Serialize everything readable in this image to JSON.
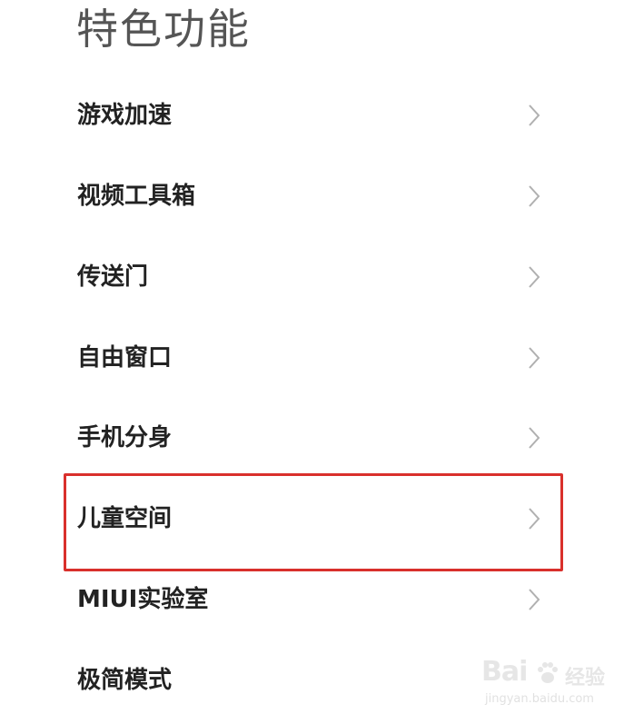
{
  "header": {
    "title": "特色功能"
  },
  "settings": {
    "items": [
      {
        "label": "游戏加速"
      },
      {
        "label": "视频工具箱"
      },
      {
        "label": "传送门"
      },
      {
        "label": "自由窗口"
      },
      {
        "label": "手机分身"
      },
      {
        "label": "儿童空间"
      },
      {
        "label": "MIUI实验室"
      },
      {
        "label": "极简模式"
      }
    ],
    "chevron_icon": "chevron-right-icon"
  },
  "highlight": {
    "target": "儿童空间",
    "color": "#d9302c"
  },
  "watermark": {
    "brand": "Bai",
    "brand_suffix": "经验",
    "url": "jingyan.baidu.com"
  }
}
